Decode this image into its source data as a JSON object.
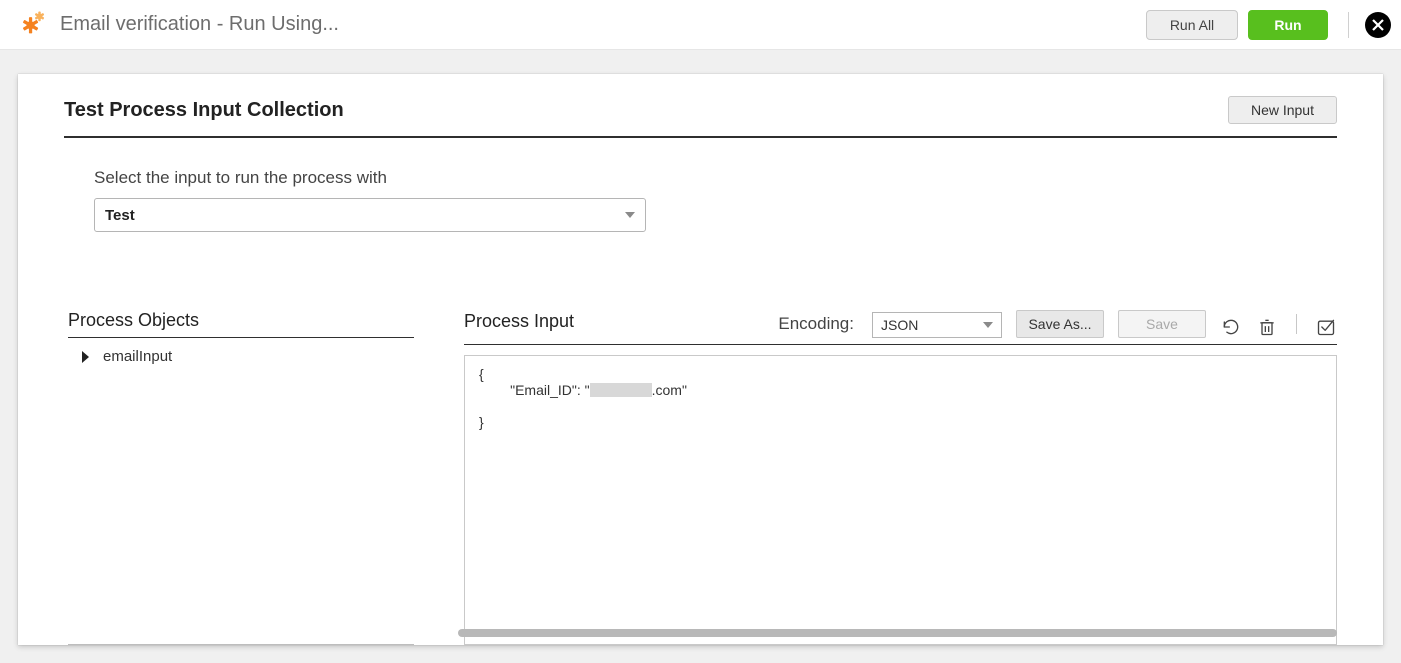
{
  "topbar": {
    "title": "Email verification - Run Using...",
    "run_all_label": "Run All",
    "run_label": "Run"
  },
  "dialog": {
    "title": "Test Process Input Collection",
    "new_input_label": "New Input",
    "select_label": "Select the input to run the process with",
    "input_selected": "Test"
  },
  "left": {
    "section_title": "Process Objects",
    "tree": [
      {
        "label": "emailInput"
      }
    ]
  },
  "right": {
    "section_title": "Process Input",
    "encoding_label": "Encoding:",
    "encoding_value": "JSON",
    "save_as_label": "Save As...",
    "save_label": "Save",
    "json_line_open": "{",
    "json_line_kv_prefix": "        \"Email_ID\": \"",
    "json_line_kv_suffix": ".com\"",
    "json_line_close": "}"
  }
}
